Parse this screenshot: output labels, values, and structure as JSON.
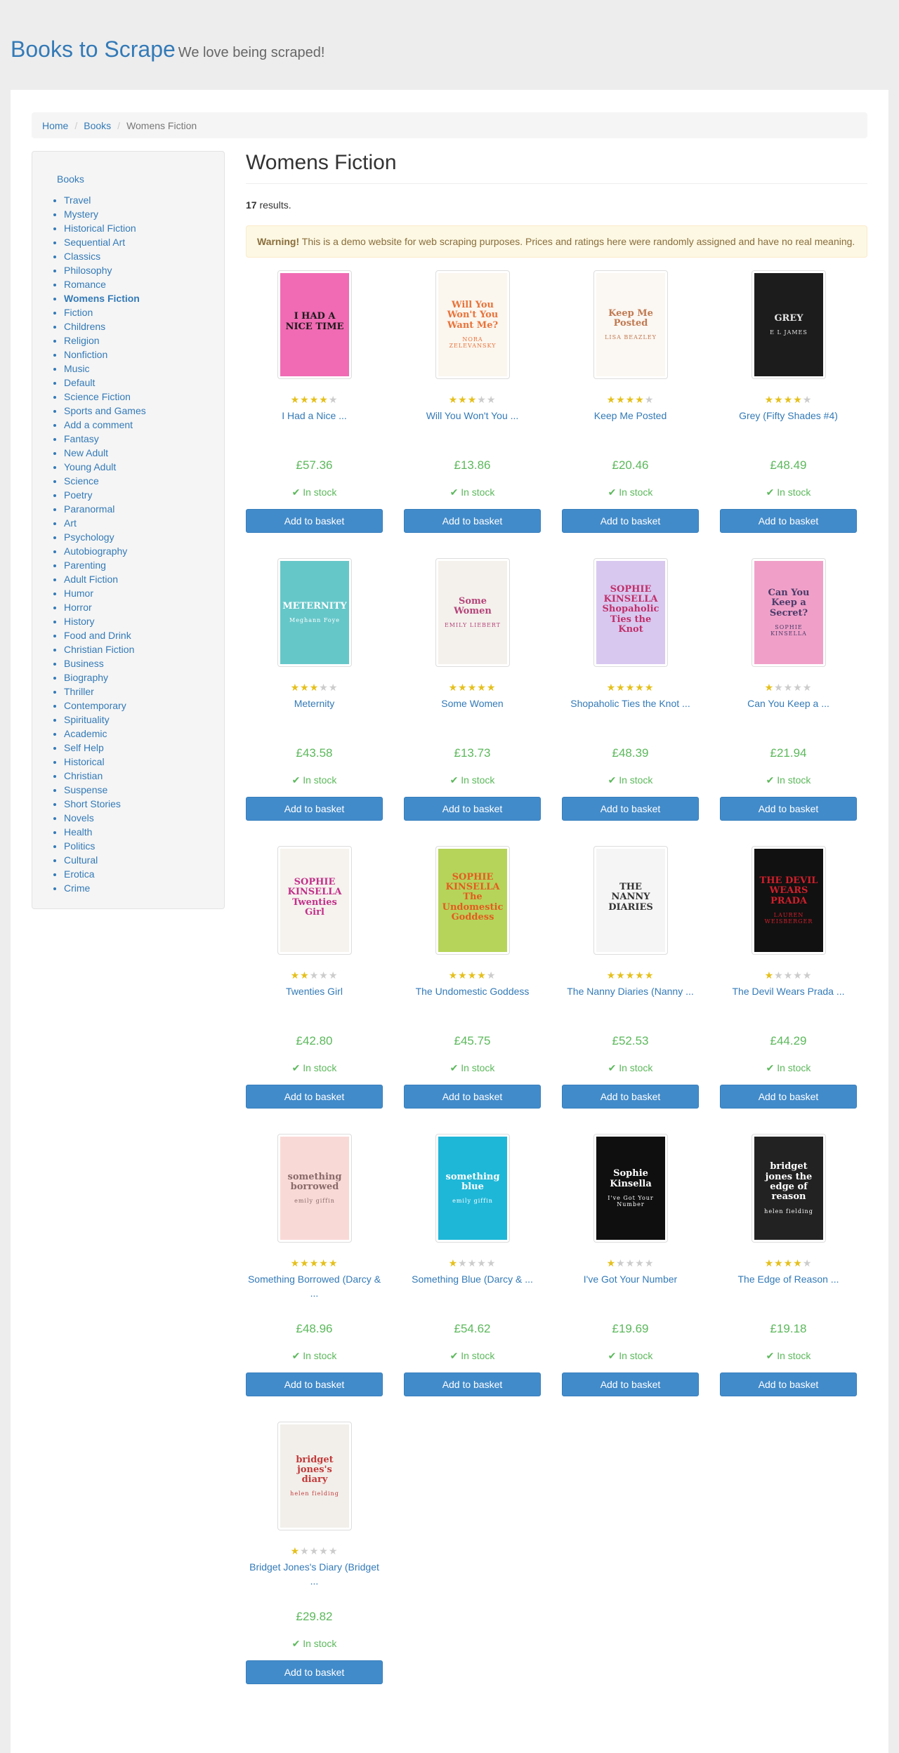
{
  "header": {
    "brand": "Books to Scrape",
    "tagline": "We love being scraped!"
  },
  "breadcrumb": {
    "home": "Home",
    "books": "Books",
    "current": "Womens Fiction"
  },
  "sidebar": {
    "root": "Books",
    "active": "Womens Fiction",
    "items": [
      "Travel",
      "Mystery",
      "Historical Fiction",
      "Sequential Art",
      "Classics",
      "Philosophy",
      "Romance",
      "Womens Fiction",
      "Fiction",
      "Childrens",
      "Religion",
      "Nonfiction",
      "Music",
      "Default",
      "Science Fiction",
      "Sports and Games",
      "Add a comment",
      "Fantasy",
      "New Adult",
      "Young Adult",
      "Science",
      "Poetry",
      "Paranormal",
      "Art",
      "Psychology",
      "Autobiography",
      "Parenting",
      "Adult Fiction",
      "Humor",
      "Horror",
      "History",
      "Food and Drink",
      "Christian Fiction",
      "Business",
      "Biography",
      "Thriller",
      "Contemporary",
      "Spirituality",
      "Academic",
      "Self Help",
      "Historical",
      "Christian",
      "Suspense",
      "Short Stories",
      "Novels",
      "Health",
      "Politics",
      "Cultural",
      "Erotica",
      "Crime"
    ]
  },
  "main": {
    "heading": "Womens Fiction",
    "results_count": "17",
    "results_suffix": " results.",
    "warning_label": "Warning!",
    "warning_text": " This is a demo website for web scraping purposes. Prices and ratings here were randomly assigned and have no real meaning.",
    "button_label": "Add to basket",
    "stock_label": "In stock"
  },
  "books": [
    {
      "title": "I Had a Nice ...",
      "price": "£57.36",
      "rating": 4,
      "cover_text": "I HAD A NICE TIME",
      "cover_author": "",
      "cover_bg": "#f06bb3",
      "cover_fg": "#1a1a1a"
    },
    {
      "title": "Will You Won't You ...",
      "price": "£13.86",
      "rating": 3,
      "cover_text": "Will You Won't You Want Me?",
      "cover_author": "NORA ZELEVANSKY",
      "cover_bg": "#fbf6ee",
      "cover_fg": "#e8733a"
    },
    {
      "title": "Keep Me Posted",
      "price": "£20.46",
      "rating": 4,
      "cover_text": "Keep Me Posted",
      "cover_author": "LISA BEAZLEY",
      "cover_bg": "#fbf7f2",
      "cover_fg": "#c07a52"
    },
    {
      "title": "Grey (Fifty Shades #4)",
      "price": "£48.49",
      "rating": 4,
      "cover_text": "GREY",
      "cover_author": "E L JAMES",
      "cover_bg": "#1c1c1c",
      "cover_fg": "#e6e6e6"
    },
    {
      "title": "Meternity",
      "price": "£43.58",
      "rating": 3,
      "cover_text": "METERNITY",
      "cover_author": "Meghann Foye",
      "cover_bg": "#66c7c9",
      "cover_fg": "#ffffff"
    },
    {
      "title": "Some Women",
      "price": "£13.73",
      "rating": 5,
      "cover_text": "Some Women",
      "cover_author": "EMILY LIEBERT",
      "cover_bg": "#f4f1ec",
      "cover_fg": "#b5457a"
    },
    {
      "title": "Shopaholic Ties the Knot ...",
      "price": "£48.39",
      "rating": 5,
      "cover_text": "SOPHIE KINSELLA Shopaholic Ties the Knot",
      "cover_author": "",
      "cover_bg": "#d8c8f0",
      "cover_fg": "#c0306a"
    },
    {
      "title": "Can You Keep a ...",
      "price": "£21.94",
      "rating": 1,
      "cover_text": "Can You Keep a Secret?",
      "cover_author": "SOPHIE KINSELLA",
      "cover_bg": "#f0a0c8",
      "cover_fg": "#4a3b6a"
    },
    {
      "title": "Twenties Girl",
      "price": "£42.80",
      "rating": 2,
      "cover_text": "SOPHIE KINSELLA Twenties Girl",
      "cover_author": "",
      "cover_bg": "#f6f3ee",
      "cover_fg": "#c2308a"
    },
    {
      "title": "The Undomestic Goddess",
      "price": "£45.75",
      "rating": 4,
      "cover_text": "SOPHIE KINSELLA The Undomestic Goddess",
      "cover_author": "",
      "cover_bg": "#b6d45a",
      "cover_fg": "#e45c1f"
    },
    {
      "title": "The Nanny Diaries (Nanny ...",
      "price": "£52.53",
      "rating": 5,
      "cover_text": "THE NANNY DIARIES",
      "cover_author": "",
      "cover_bg": "#f5f5f5",
      "cover_fg": "#333333"
    },
    {
      "title": "The Devil Wears Prada ...",
      "price": "£44.29",
      "rating": 1,
      "cover_text": "THE DEVIL WEARS PRADA",
      "cover_author": "LAUREN WEISBERGER",
      "cover_bg": "#111111",
      "cover_fg": "#d01f2b"
    },
    {
      "title": "Something Borrowed (Darcy & ...",
      "price": "£48.96",
      "rating": 5,
      "cover_text": "something borrowed",
      "cover_author": "emily giffin",
      "cover_bg": "#f9d9d6",
      "cover_fg": "#8a6a6a"
    },
    {
      "title": "Something Blue (Darcy & ...",
      "price": "£54.62",
      "rating": 1,
      "cover_text": "something blue",
      "cover_author": "emily giffin",
      "cover_bg": "#1fb7d8",
      "cover_fg": "#ffffff"
    },
    {
      "title": "I've Got Your Number",
      "price": "£19.69",
      "rating": 1,
      "cover_text": "Sophie Kinsella",
      "cover_author": "I've Got Your Number",
      "cover_bg": "#0f0f0f",
      "cover_fg": "#ffffff"
    },
    {
      "title": "The Edge of Reason ...",
      "price": "£19.18",
      "rating": 4,
      "cover_text": "bridget jones the edge of reason",
      "cover_author": "helen fielding",
      "cover_bg": "#222222",
      "cover_fg": "#ffffff"
    },
    {
      "title": "Bridget Jones's Diary (Bridget ...",
      "price": "£29.82",
      "rating": 1,
      "cover_text": "bridget jones's diary",
      "cover_author": "helen fielding",
      "cover_bg": "#f2efea",
      "cover_fg": "#c23a3a"
    }
  ]
}
